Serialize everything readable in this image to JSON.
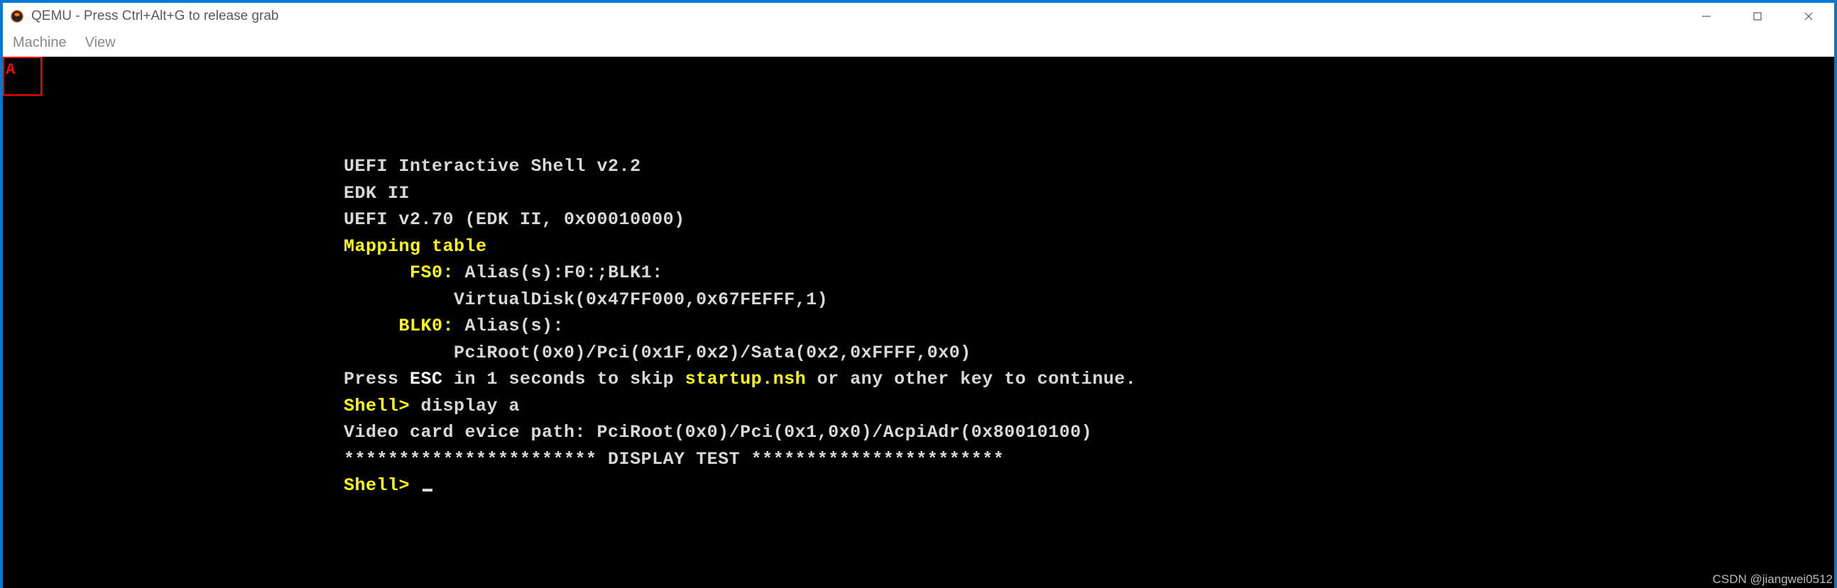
{
  "window": {
    "title": "QEMU - Press Ctrl+Alt+G to release grab"
  },
  "menubar": {
    "items": [
      "Machine",
      "View"
    ]
  },
  "highlight": {
    "char": "A"
  },
  "shell": {
    "lines": [
      {
        "segments": [
          {
            "cls": "c-white",
            "text": "UEFI Interactive Shell v2.2"
          }
        ]
      },
      {
        "segments": [
          {
            "cls": "c-white",
            "text": "EDK II"
          }
        ]
      },
      {
        "segments": [
          {
            "cls": "c-white",
            "text": "UEFI v2.70 (EDK II, 0x00010000)"
          }
        ]
      },
      {
        "segments": [
          {
            "cls": "c-yellow",
            "text": "Mapping table"
          }
        ]
      },
      {
        "segments": [
          {
            "cls": "c-yellow",
            "text": "      FS0:"
          },
          {
            "cls": "c-white",
            "text": " Alias(s):F0:;BLK1:"
          }
        ]
      },
      {
        "segments": [
          {
            "cls": "c-white",
            "text": "          VirtualDisk(0x47FF000,0x67FEFFF,1)"
          }
        ]
      },
      {
        "segments": [
          {
            "cls": "c-yellow",
            "text": "     BLK0:"
          },
          {
            "cls": "c-white",
            "text": " Alias(s):"
          }
        ]
      },
      {
        "segments": [
          {
            "cls": "c-white",
            "text": "          PciRoot(0x0)/Pci(0x1F,0x2)/Sata(0x2,0xFFFF,0x0)"
          }
        ]
      },
      {
        "segments": [
          {
            "cls": "c-white",
            "text": "Press "
          },
          {
            "cls": "c-bwhite",
            "text": "ESC"
          },
          {
            "cls": "c-white",
            "text": " in 1 seconds to skip "
          },
          {
            "cls": "c-yellow",
            "text": "startup.nsh"
          },
          {
            "cls": "c-white",
            "text": " or any other key to continue."
          }
        ]
      },
      {
        "segments": [
          {
            "cls": "c-yellow",
            "text": "Shell> "
          },
          {
            "cls": "c-white",
            "text": "display a"
          }
        ]
      },
      {
        "segments": [
          {
            "cls": "c-white",
            "text": "Video card evice path: PciRoot(0x0)/Pci(0x1,0x0)/AcpiAdr(0x80010100)"
          }
        ]
      },
      {
        "segments": [
          {
            "cls": "c-white",
            "text": "*********************** DISPLAY TEST ***********************"
          }
        ]
      },
      {
        "segments": [
          {
            "cls": "c-yellow",
            "text": "Shell> "
          }
        ],
        "cursor": true
      }
    ]
  },
  "watermark": "CSDN @jiangwei0512"
}
